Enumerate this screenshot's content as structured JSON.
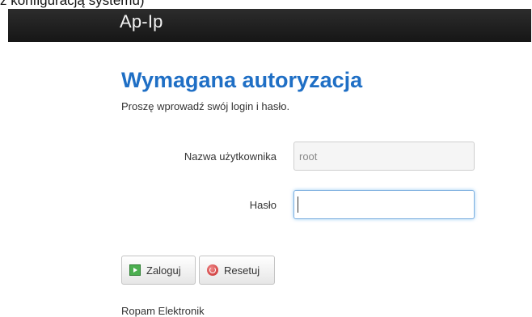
{
  "top_text": "z konfiguracją systemu)",
  "header": {
    "brand": "Ap-Ip"
  },
  "login": {
    "title": "Wymagana autoryzacja",
    "subtitle": "Proszę wprowadź swój login i hasło.",
    "username_label": "Nazwa użytkownika",
    "username_value": "root",
    "password_label": "Hasło",
    "password_value": ""
  },
  "buttons": {
    "login": "Zaloguj",
    "reset": "Resetuj"
  },
  "footer": {
    "text": "Ropam Elektronik"
  },
  "colors": {
    "title": "#1f6fc5",
    "topbar": "#1e1e1e"
  },
  "icons": {
    "login": "play-icon",
    "reset": "reset-icon"
  }
}
